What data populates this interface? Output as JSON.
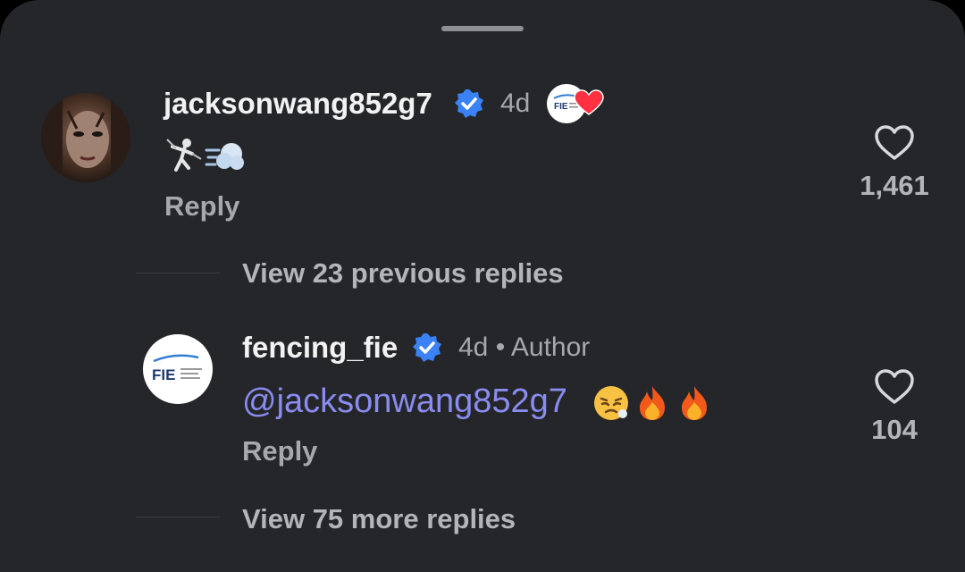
{
  "comments": [
    {
      "username": "jacksonwang852g7",
      "time": "4d",
      "reply_label": "Reply",
      "like_count": "1,461",
      "emoji_text": [
        "fencer",
        "dash"
      ]
    },
    {
      "username": "fencing_fie",
      "time": "4d",
      "author_label": "• Author",
      "mention": "@jacksonwang852g7",
      "emoji_text": [
        "tired-face",
        "fire",
        "fire"
      ],
      "reply_label": "Reply",
      "like_count": "104"
    }
  ],
  "view_previous": "View 23 previous replies",
  "view_more": "View 75 more replies",
  "fie_logo_text": "FIE",
  "colors": {
    "sheet": "#25262a",
    "verified": "#3b82f6",
    "mention": "#8a8cf0",
    "heart_badge": "#ff3040"
  }
}
